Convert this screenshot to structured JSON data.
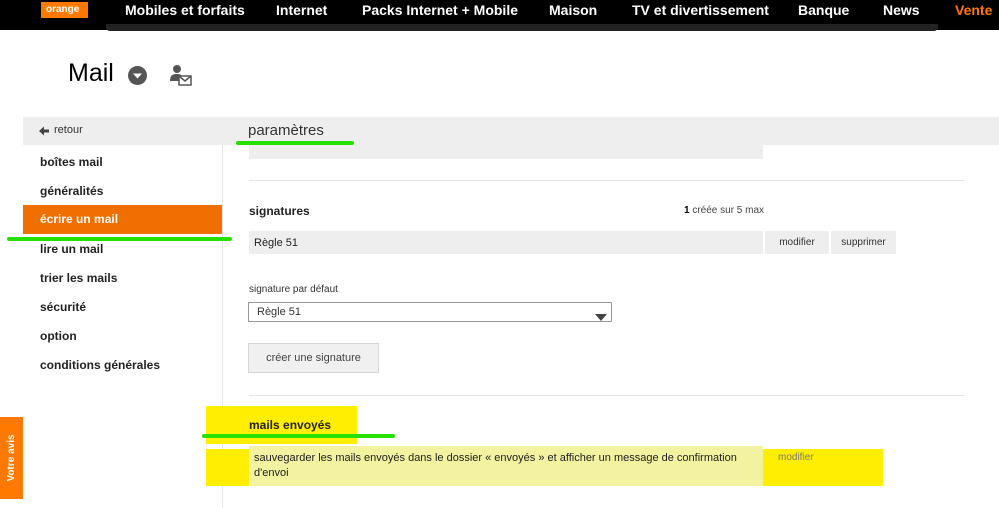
{
  "topnav": {
    "logo": "orange",
    "items": [
      "Mobiles et forfaits",
      "Internet",
      "Packs Internet + Mobile",
      "Maison",
      "TV et divertissement",
      "Banque",
      "News",
      "Vente"
    ]
  },
  "header": {
    "title": "Mail"
  },
  "back_label": "retour",
  "params_title": "paramètres",
  "sidebar": {
    "items": [
      "boîtes mail",
      "généralités",
      "écrire un mail",
      "lire un mail",
      "trier les mails",
      "sécurité",
      "option",
      "conditions générales"
    ],
    "active": "écrire un mail"
  },
  "signatures": {
    "title": "signatures",
    "count": "1",
    "count_suffix": " créée sur 5 max",
    "row_name": "Règle 51",
    "modify_label": "modifier",
    "delete_label": "supprimer",
    "default_label": "signature par défaut",
    "default_value": "Règle 51",
    "create_label": "créer une signature"
  },
  "sent": {
    "title": "mails envoyés",
    "description": "sauvegarder les mails envoyés dans le dossier « envoyés » et afficher un message de confirmation d'envoi",
    "modify_label": "modifier"
  },
  "feedback_tab": "Votre avis",
  "colors": {
    "brand_orange": "#ff7900",
    "active_orange": "#f16e00",
    "annotation_green": "#26e000",
    "highlight_yellow": "#ffee00"
  }
}
